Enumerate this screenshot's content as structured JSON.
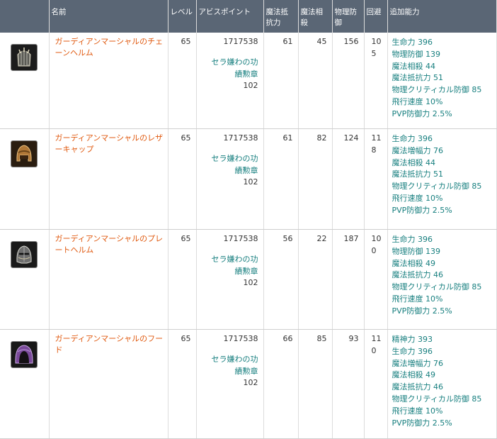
{
  "headers": {
    "name": "名前",
    "level": "レベル",
    "abyss": "アビスポイント",
    "mres": [
      "魔法抵",
      "抗力"
    ],
    "msup": [
      "魔法相",
      "殺"
    ],
    "pdef": [
      "物理防",
      "御"
    ],
    "dodge": "回避",
    "bonus": "追加能力"
  },
  "rows": [
    {
      "icon": "chain-helm-icon",
      "name": "ガーディアンマーシャルのチェーンヘルム",
      "level": "65",
      "abyss": "1717538",
      "medal": [
        "セラ嫌わの功",
        "績勲章"
      ],
      "medal_count": "102",
      "mres": "61",
      "msup": "45",
      "pdef": "156",
      "dodge": [
        "10",
        "5"
      ],
      "bonus": [
        "生命力 396",
        "物理防御 139",
        "魔法相殺 44",
        "魔法抵抗力 51",
        "物理クリティカル防御 85",
        "飛行速度 10%",
        "PVP防御力 2.5%"
      ]
    },
    {
      "icon": "leather-cap-icon",
      "name": "ガーディアンマーシャルのレザーキャップ",
      "level": "65",
      "abyss": "1717538",
      "medal": [
        "セラ嫌わの功",
        "績勲章"
      ],
      "medal_count": "102",
      "mres": "61",
      "msup": "82",
      "pdef": "124",
      "dodge": [
        "11",
        "8"
      ],
      "bonus": [
        "生命力 396",
        "魔法増幅力 76",
        "魔法相殺 44",
        "魔法抵抗力 51",
        "物理クリティカル防御 85",
        "飛行速度 10%",
        "PVP防御力 2.5%"
      ]
    },
    {
      "icon": "plate-helm-icon",
      "name": "ガーディアンマーシャルのプレートヘルム",
      "level": "65",
      "abyss": "1717538",
      "medal": [
        "セラ嫌わの功",
        "績勲章"
      ],
      "medal_count": "102",
      "mres": "56",
      "msup": "22",
      "pdef": "187",
      "dodge": [
        "10",
        "0"
      ],
      "bonus": [
        "生命力 396",
        "物理防御 139",
        "魔法相殺 49",
        "魔法抵抗力 46",
        "物理クリティカル防御 85",
        "飛行速度 10%",
        "PVP防御力 2.5%"
      ]
    },
    {
      "icon": "hood-icon",
      "name": "ガーディアンマーシャルのフード",
      "level": "65",
      "abyss": "1717538",
      "medal": [
        "セラ嫌わの功",
        "績勲章"
      ],
      "medal_count": "102",
      "mres": "66",
      "msup": "85",
      "pdef": "93",
      "dodge": [
        "11",
        "0"
      ],
      "bonus": [
        "精神力 393",
        "生命力 396",
        "魔法増幅力 76",
        "魔法相殺 49",
        "魔法抵抗力 46",
        "物理クリティカル防御 85",
        "飛行速度 10%",
        "PVP防御力 2.5%"
      ]
    }
  ]
}
